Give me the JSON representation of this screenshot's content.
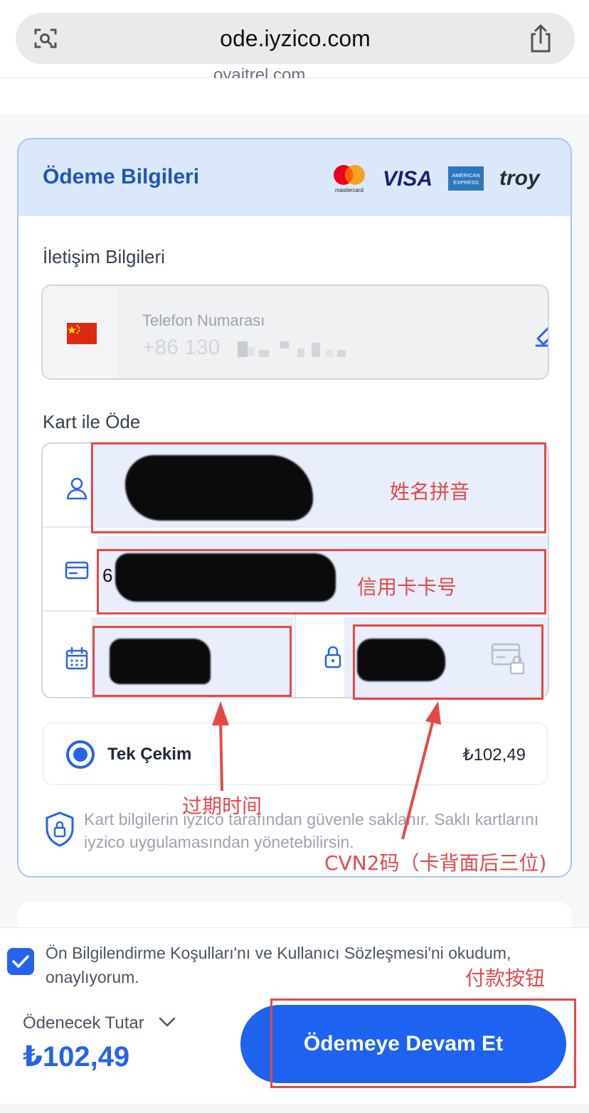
{
  "browser": {
    "url": "ode.iyzico.com",
    "cut_text": "oyaitrel.com"
  },
  "card": {
    "title": "Ödeme Bilgileri",
    "logos": {
      "mastercard": "mastercard",
      "visa": "VISA",
      "amex": "AMERICAN EXPRESS",
      "troy": "troy"
    }
  },
  "contact": {
    "section": "İletişim Bilgileri",
    "phone_label": "Telefon Numarası",
    "phone_value": "+86 130"
  },
  "pay_card": {
    "section": "Kart ile Öde",
    "card_number_prefix": "6"
  },
  "installment": {
    "label": "Tek Çekim",
    "amount": "₺102,49"
  },
  "secure_note": "Kart bilgilerin iyzico tarafından güvenle saklanır. Saklı kartlarını iyzico uygulamasından yönetebilirsin.",
  "footer": {
    "consent": "Ön Bilgilendirme Koşulları'nı ve Kullanıcı Sözleşmesi'ni okudum, onaylıyorum.",
    "total_label": "Ödenecek Tutar",
    "total_value": "₺102,49",
    "pay_button": "Ödemeye Devam Et"
  },
  "annotations": {
    "name": "姓名拼音",
    "card_number": "信用卡卡号",
    "expiry": "过期时间",
    "cvn": "CVN2码（卡背面后三位)",
    "pay": "付款按钮",
    "color": "#e64848"
  },
  "colors": {
    "accent": "#1e62f0",
    "header_bg": "#dbe8fb",
    "title": "#1f55b8"
  }
}
